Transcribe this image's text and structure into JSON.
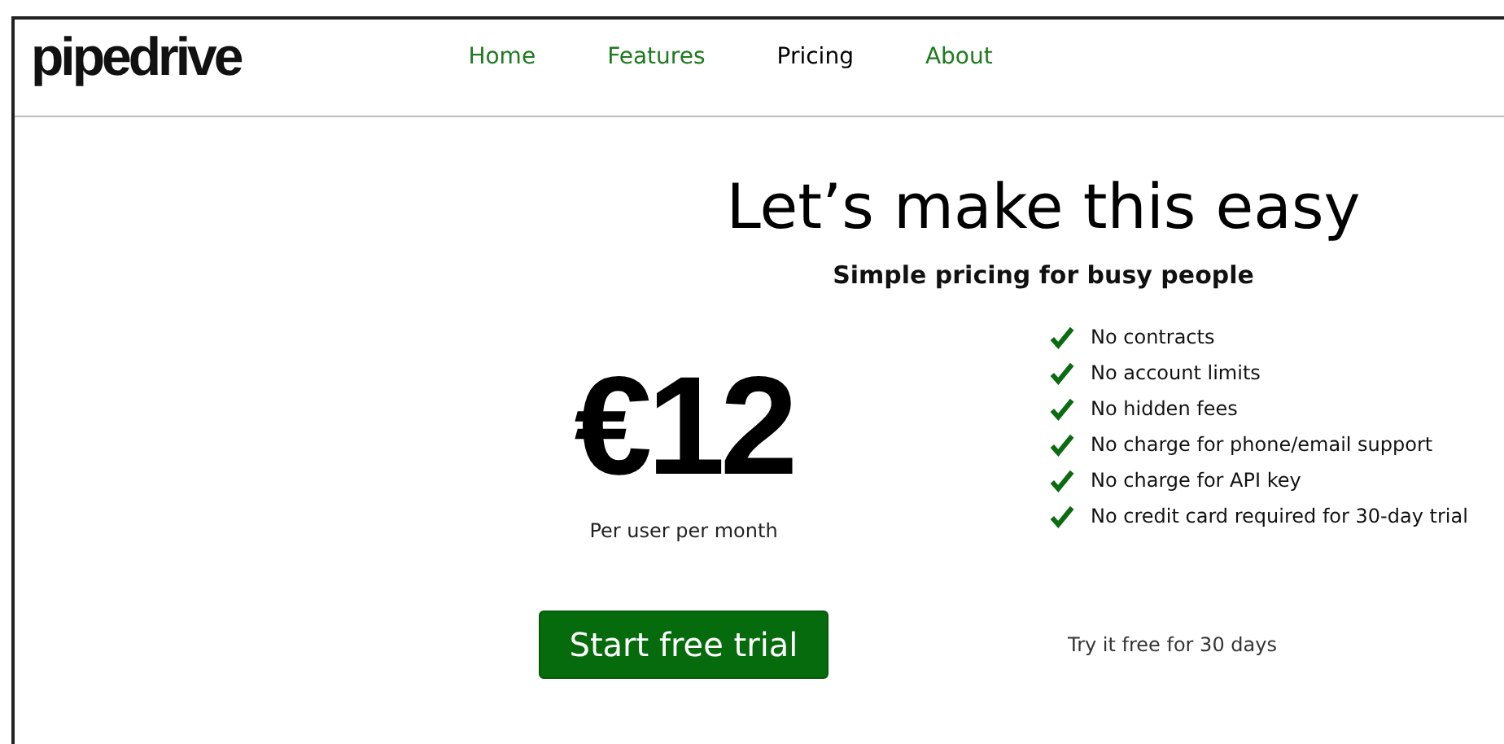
{
  "logo": "pipedrive",
  "nav": [
    {
      "label": "Home",
      "selected": false
    },
    {
      "label": "Features",
      "selected": false
    },
    {
      "label": "Pricing",
      "selected": true
    },
    {
      "label": "About",
      "selected": false
    }
  ],
  "headline": "Let’s make this easy",
  "subheadline": "Simple pricing for busy people",
  "price": {
    "amount": "€12",
    "period": "Per user per month"
  },
  "features": [
    "No contracts",
    "No account limits",
    "No hidden fees",
    "No charge for phone/email support",
    "No charge for API key",
    "No credit card required for 30-day trial"
  ],
  "cta": {
    "button": "Start free trial",
    "note": "Try it free for 30 days"
  }
}
